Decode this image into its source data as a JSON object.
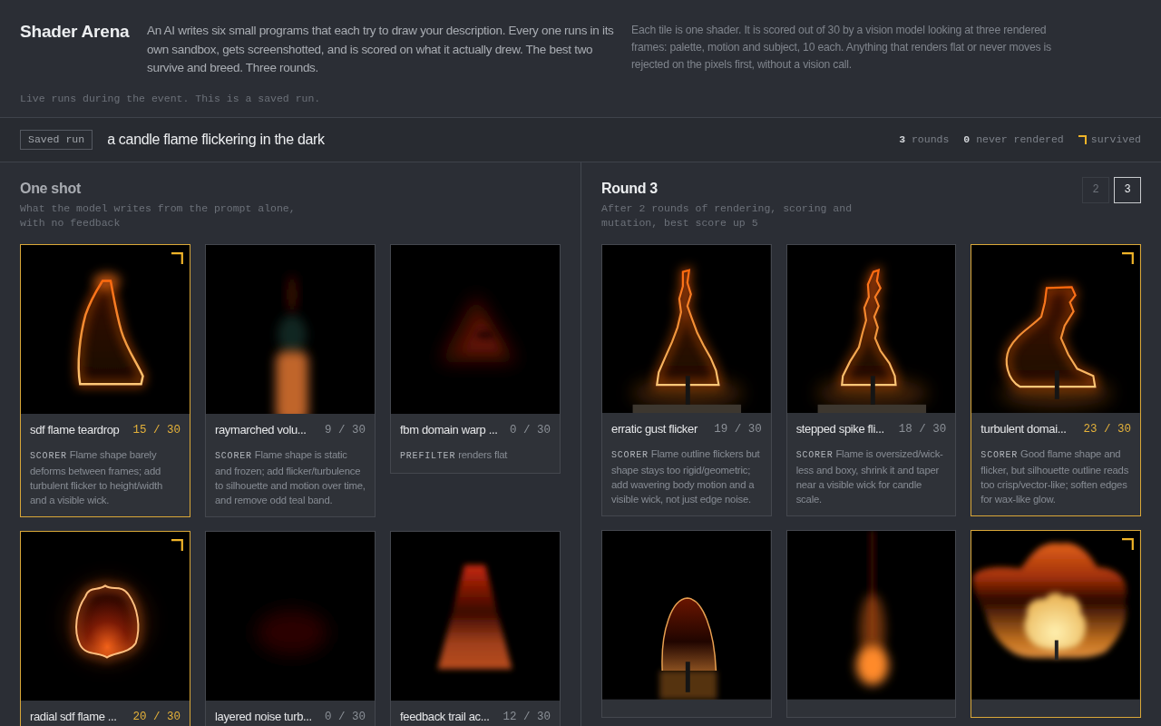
{
  "header": {
    "title": "Shader Arena",
    "intro": "An AI writes six small programs that each try to draw your description. Every one runs in its own sandbox, gets screenshotted, and is scored on what it actually drew. The best two survive and breed. Three rounds.",
    "details": "Each tile is one shader. It is scored out of 30 by a vision model looking at three rendered frames: palette, motion and subject, 10 each. Anything that renders flat or never moves is rejected on the pixels first, without a vision call.",
    "note": "Live runs during the event. This is a saved run."
  },
  "toolbar": {
    "badge": "Saved run",
    "prompt": "a candle flame flickering in the dark",
    "stats": [
      "**3** rounds",
      "**0** never rendered"
    ],
    "legend": {
      "label": "survived"
    }
  },
  "panels": [
    {
      "kind": "baseline",
      "title": "One shot",
      "subtitle": "What the model writes from the prompt alone, with no feedback",
      "cards": [
        {
          "name": "sdf flame teardrop",
          "score": "15 / 30",
          "survived": true,
          "source": "SCORER",
          "note": "Flame shape barely deforms between frames; add turbulent flicker to height/width and a visible wick."
        },
        {
          "name": "raymarched volu...",
          "score": "9 / 30",
          "survived": false,
          "source": "SCORER",
          "note": "Flame shape is static and frozen; add flicker/turbulence to silhouette and motion over time, and remove odd teal band."
        },
        {
          "name": "fbm domain warp ...",
          "score": "0 / 30",
          "survived": false,
          "source": "PREFILTER",
          "note": "renders flat"
        },
        {
          "name": "radial sdf flame ...",
          "score": "20 / 30",
          "survived": true
        },
        {
          "name": "layered noise turb...",
          "score": "0 / 30",
          "survived": false
        },
        {
          "name": "feedback trail ac...",
          "score": "12 / 30",
          "survived": false
        }
      ]
    },
    {
      "kind": "round",
      "title": "Round 3",
      "subtitle": "After 2 rounds of rendering, scoring and mutation, best score up 5",
      "round_tabs": [
        {
          "label": "2",
          "selected": false
        },
        {
          "label": "3",
          "selected": true
        }
      ],
      "cards": [
        {
          "name": "erratic gust flicker",
          "score": "19 / 30",
          "survived": false,
          "source": "SCORER",
          "note": "Flame outline flickers but shape stays too rigid/geometric; add wavering body motion and a visible wick, not just edge noise."
        },
        {
          "name": "stepped spike fli...",
          "score": "18 / 30",
          "survived": false,
          "source": "SCORER",
          "note": "Flame is oversized/wick-less and boxy, shrink it and taper near a visible wick for candle scale."
        },
        {
          "name": "turbulent domai...",
          "score": "23 / 30",
          "survived": true,
          "source": "SCORER",
          "note": "Good flame shape and flicker, but silhouette outline reads too crisp/vector-like; soften edges for wax-like glow."
        },
        {
          "survived": false
        },
        {
          "survived": false
        },
        {
          "survived": true
        }
      ]
    }
  ]
}
